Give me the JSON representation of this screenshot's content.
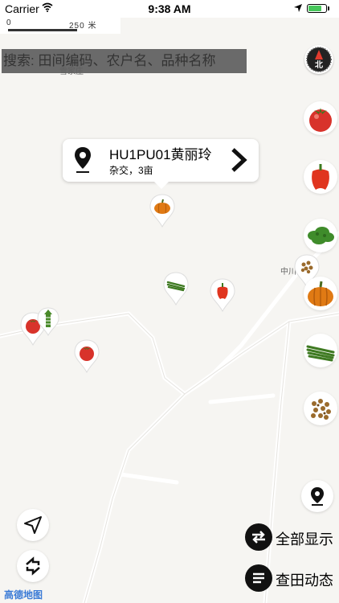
{
  "status_bar": {
    "carrier": "Carrier",
    "time": "9:38 AM",
    "battery_level": 0.75
  },
  "map": {
    "scale_zero": "0",
    "scale_label": "250 米",
    "place_labels": [
      "雪家庄",
      "中川"
    ]
  },
  "search": {
    "placeholder": "搜索: 田间编码、农户名、品种名称"
  },
  "compass": {
    "label": "北"
  },
  "popup": {
    "title": "HU1PU01黄丽玲",
    "subtitle": "杂交，3亩"
  },
  "markers": [
    {
      "crop": "pumpkin"
    },
    {
      "crop": "green-bean"
    },
    {
      "crop": "pepper"
    },
    {
      "crop": "tomato"
    },
    {
      "crop": "tomato"
    },
    {
      "crop": "seed"
    },
    {
      "crop": "corn"
    }
  ],
  "crop_filters": [
    {
      "crop": "tomato"
    },
    {
      "crop": "pepper"
    },
    {
      "crop": "leafy-greens"
    },
    {
      "crop": "pumpkin"
    },
    {
      "crop": "green-bean"
    },
    {
      "crop": "seed"
    }
  ],
  "actions": {
    "show_all_label": "全部显示",
    "field_updates_label": "查田动态"
  },
  "footer": {
    "logo": "高德地图"
  },
  "colors": {
    "tomato": "#d8332b",
    "pepper": "#e0351f",
    "pumpkin": "#e07a14",
    "greens": "#3f8c2b",
    "accent_blue": "#3b7bd6"
  }
}
